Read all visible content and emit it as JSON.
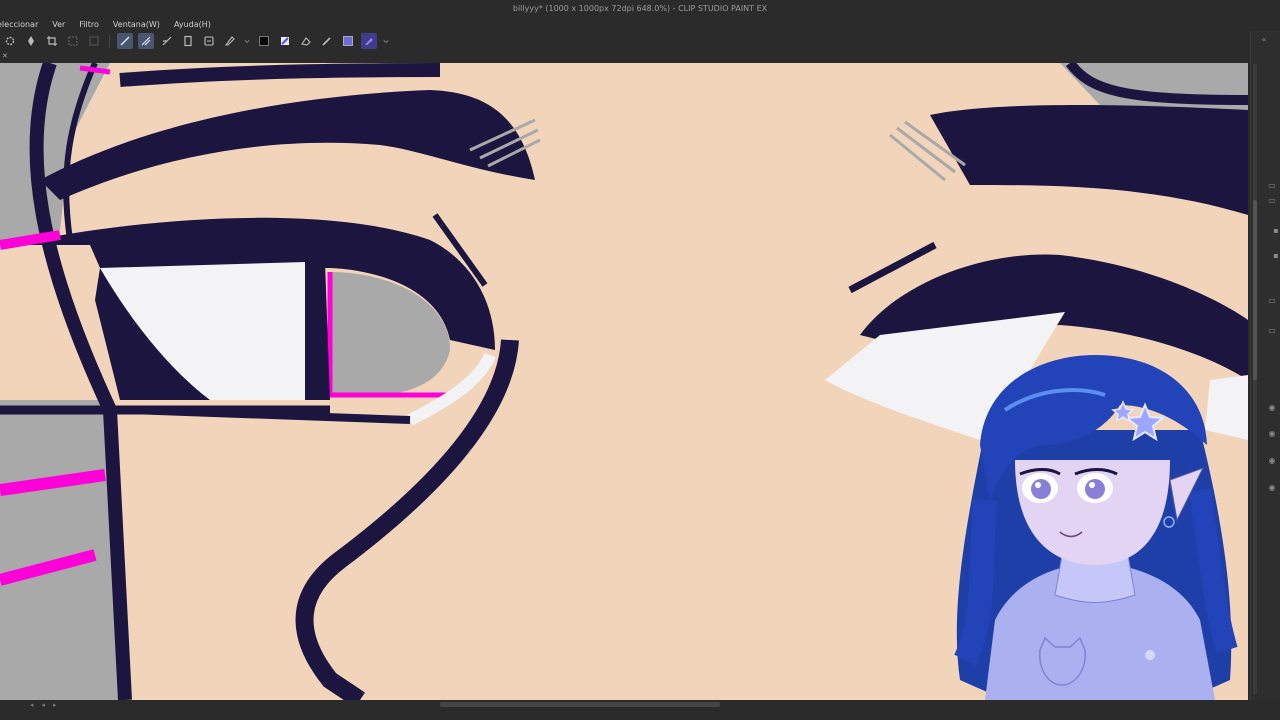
{
  "window": {
    "title": "billyyy* (1000 x 1000px 72dpi 648.0%) - CLIP STUDIO PAINT EX"
  },
  "menu": {
    "items": [
      "eleccionar",
      "Ver",
      "Filtro",
      "Ventana(W)",
      "Ayuda(H)"
    ]
  },
  "toolbar": {
    "tools": [
      {
        "name": "transform-icon",
        "active": false
      },
      {
        "name": "move-layer-icon",
        "active": false
      },
      {
        "name": "crop-icon",
        "active": false
      },
      {
        "name": "select-icon",
        "active": false
      },
      {
        "name": "lasso-icon",
        "active": false
      },
      {
        "name": "pen-line-icon",
        "active": true
      },
      {
        "name": "pen-alt-icon",
        "active": true
      },
      {
        "name": "ruler-icon",
        "active": false
      },
      {
        "name": "layer-icon",
        "active": false
      },
      {
        "name": "reference-icon",
        "active": false
      },
      {
        "name": "pen-tool-icon",
        "active": false
      }
    ],
    "current_color": "#0a0a0a"
  },
  "colors": {
    "skin": "#f1d4ba",
    "lineart": "#1c1540",
    "gray": "#a7a7a7",
    "white": "#f3f2f4",
    "magenta": "#ff00d8",
    "chrome": "#2b2b2b"
  }
}
